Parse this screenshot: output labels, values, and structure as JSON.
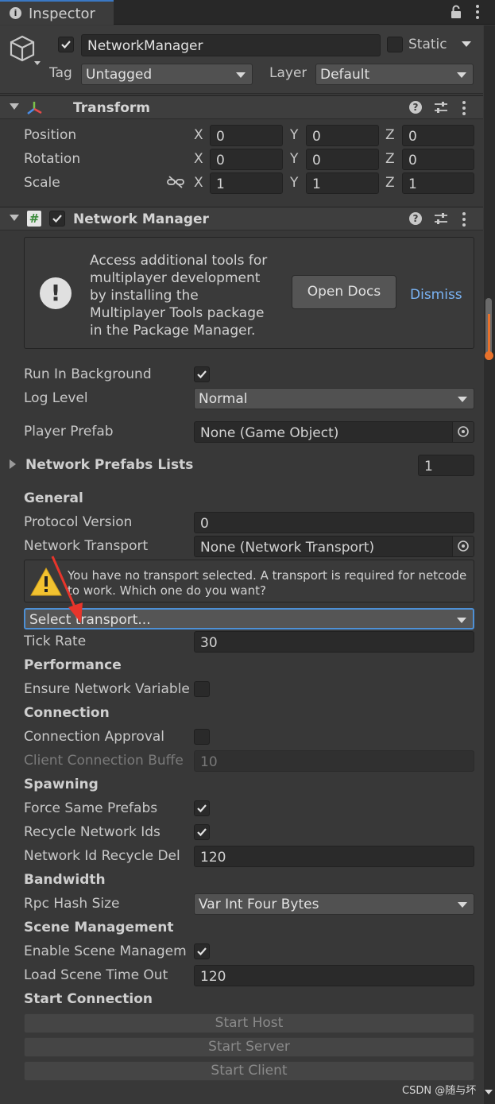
{
  "tab": {
    "title": "Inspector"
  },
  "object": {
    "name": "NetworkManager",
    "static_label": "Static",
    "tag_label": "Tag",
    "tag_value": "Untagged",
    "layer_label": "Layer",
    "layer_value": "Default"
  },
  "transform": {
    "title": "Transform",
    "rows": [
      {
        "label": "Position",
        "x": "0",
        "y": "0",
        "z": "0"
      },
      {
        "label": "Rotation",
        "x": "0",
        "y": "0",
        "z": "0"
      },
      {
        "label": "Scale",
        "x": "1",
        "y": "1",
        "z": "1"
      }
    ],
    "axis": {
      "x": "X",
      "y": "Y",
      "z": "Z"
    }
  },
  "network_manager": {
    "title": "Network Manager",
    "info_text": [
      "Access additional tools for",
      "multiplayer development",
      "by installing the",
      "Multiplayer Tools package",
      "in the Package Manager."
    ],
    "open_docs": "Open Docs",
    "dismiss": "Dismiss",
    "run_in_background": "Run In Background",
    "log_level_label": "Log Level",
    "log_level_value": "Normal",
    "player_prefab_label": "Player Prefab",
    "player_prefab_value": "None (Game Object)",
    "prefab_lists_label": "Network Prefabs Lists",
    "prefab_lists_count": "1",
    "general": "General",
    "protocol_version_label": "Protocol Version",
    "protocol_version_value": "0",
    "network_transport_label": "Network Transport",
    "network_transport_value": "None (Network Transport)",
    "warning_line1": "You have no transport selected. A transport is required for netcode",
    "warning_line2": "to work. Which one do you want?",
    "select_transport": "Select transport...",
    "tick_rate_label": "Tick Rate",
    "tick_rate_value": "30",
    "performance": "Performance",
    "ensure_label": "Ensure Network Variable",
    "connection": "Connection",
    "connection_approval_label": "Connection Approval",
    "client_buffer_label": "Client Connection Buffe",
    "client_buffer_value": "10",
    "spawning": "Spawning",
    "force_same_label": "Force Same Prefabs",
    "recycle_ids_label": "Recycle Network Ids",
    "recycle_delay_label": "Network Id Recycle Del",
    "recycle_delay_value": "120",
    "bandwidth": "Bandwidth",
    "rpc_hash_label": "Rpc Hash Size",
    "rpc_hash_value": "Var Int Four Bytes",
    "scene_management": "Scene Management",
    "enable_scene_label": "Enable Scene Managem",
    "load_timeout_label": "Load Scene Time Out",
    "load_timeout_value": "120",
    "start_connection": "Start Connection",
    "start_host": "Start Host",
    "start_server": "Start Server",
    "start_client": "Start Client"
  },
  "watermark": "CSDN @随与坏",
  "colors": {
    "accent_link": "#7ab4f5",
    "scrollbar_orange": "#e8712b",
    "selected_outline": "#4d90d6",
    "arrow_red": "#e8352b"
  }
}
